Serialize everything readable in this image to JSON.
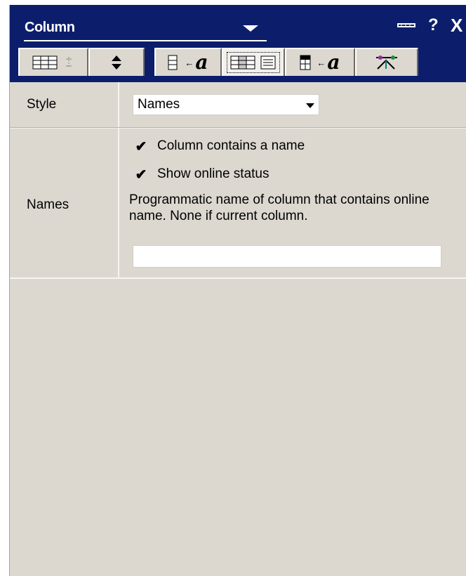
{
  "titlebar": {
    "title": "Column",
    "pin_icon": "pin-icon",
    "help_label": "?",
    "close_label": "X"
  },
  "tabs": [
    {
      "name": "column-layout",
      "icon": "grid-columns-icon"
    },
    {
      "name": "sort-order",
      "icon": "up-down-arrows-icon"
    },
    {
      "name": "field-to-text",
      "icon": "field-text-icon"
    },
    {
      "name": "column-display",
      "icon": "column-display-icon",
      "active": true
    },
    {
      "name": "header-text",
      "icon": "header-text-icon"
    },
    {
      "name": "advanced",
      "icon": "advanced-icon"
    }
  ],
  "style_row": {
    "label": "Style",
    "selected": "Names"
  },
  "names_row": {
    "label": "Names",
    "checkbox1_label": "Column contains a name",
    "checkbox1_checked": true,
    "checkbox2_label": "Show online status",
    "checkbox2_checked": true,
    "description": "Programmatic name of column that contains online name. None if current column.",
    "input_value": ""
  },
  "colors": {
    "titlebar": "#0c1e6b",
    "panel": "#dcd8d0"
  }
}
